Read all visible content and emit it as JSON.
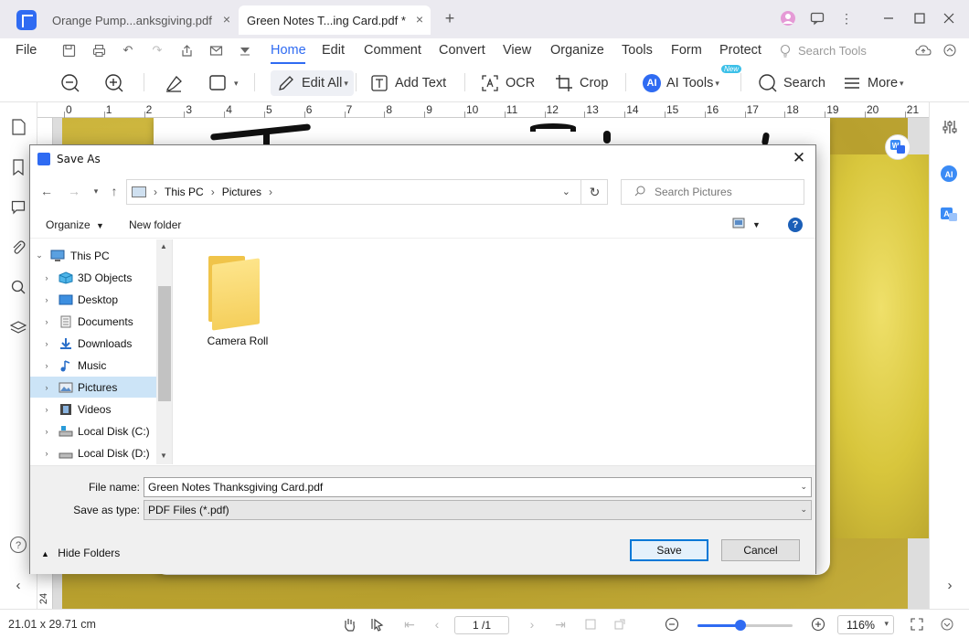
{
  "titlebar": {
    "tabs": [
      {
        "label": "Orange  Pump...anksgiving.pdf",
        "active": false
      },
      {
        "label": "Green  Notes  T...ing Card.pdf *",
        "active": true
      }
    ],
    "close_glyph": "×",
    "new_tab_glyph": "+"
  },
  "menubar": {
    "file": "File",
    "items": [
      "Home",
      "Edit",
      "Comment",
      "Convert",
      "View",
      "Organize",
      "Tools",
      "Form",
      "Protect"
    ],
    "active": "Home",
    "search_tools": "Search Tools"
  },
  "toolbar": {
    "edit_all": "Edit All",
    "add_text": "Add Text",
    "ocr": "OCR",
    "crop": "Crop",
    "ai_tools": "AI Tools",
    "ai_badge": "New",
    "search": "Search",
    "more": "More"
  },
  "ruler": {
    "top_numbers": [
      "0",
      "1",
      "2",
      "3",
      "4",
      "5",
      "6",
      "7",
      "8",
      "9",
      "10",
      "11",
      "12",
      "13",
      "14",
      "15",
      "16",
      "17",
      "18",
      "19",
      "20",
      "21"
    ],
    "left_number": "24"
  },
  "statusbar": {
    "page_size": "21.01 x 29.71 cm",
    "page_indicator": "1 /1",
    "zoom": "116%",
    "zoom_fraction": 0.45
  },
  "dialog": {
    "title": "Save As",
    "address_path": [
      "This PC",
      "Pictures"
    ],
    "search_placeholder": "Search Pictures",
    "organize": "Organize",
    "new_folder": "New folder",
    "help": "?",
    "tree": [
      {
        "label": "This PC",
        "level": 0,
        "expanded": true,
        "icon": "computer-icon"
      },
      {
        "label": "3D Objects",
        "level": 1,
        "icon": "cube-icon"
      },
      {
        "label": "Desktop",
        "level": 1,
        "icon": "desktop-icon"
      },
      {
        "label": "Documents",
        "level": 1,
        "icon": "documents-icon"
      },
      {
        "label": "Downloads",
        "level": 1,
        "icon": "download-icon"
      },
      {
        "label": "Music",
        "level": 1,
        "icon": "music-icon"
      },
      {
        "label": "Pictures",
        "level": 1,
        "icon": "pictures-icon",
        "selected": true
      },
      {
        "label": "Videos",
        "level": 1,
        "icon": "videos-icon"
      },
      {
        "label": "Local Disk (C:)",
        "level": 1,
        "icon": "disk-icon"
      },
      {
        "label": "Local Disk (D:)",
        "level": 1,
        "icon": "disk-icon"
      }
    ],
    "folders": [
      {
        "label": "Camera Roll",
        "icon": "folder-icon"
      }
    ],
    "file_name_label": "File name:",
    "file_name_value": "Green Notes Thanksgiving Card.pdf",
    "save_type_label": "Save as type:",
    "save_type_value": "PDF Files (*.pdf)",
    "hide_folders": "Hide Folders",
    "save": "Save",
    "cancel": "Cancel"
  },
  "colors": {
    "accent": "#2f6bf2",
    "selection": "#cce4f7",
    "dialog_primary_border": "#0078d7"
  }
}
